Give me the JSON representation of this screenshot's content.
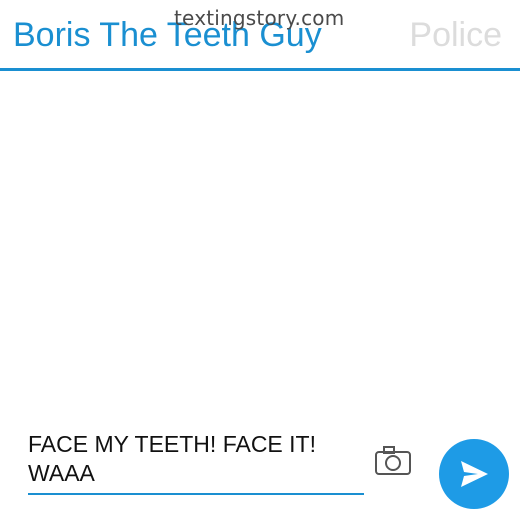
{
  "watermark": "textingstory.com",
  "header": {
    "active_contact": "Boris The Teeth Guy",
    "inactive_contact": "Police"
  },
  "composer": {
    "text": "FACE MY TEETH! FACE IT!\nWAAA"
  },
  "icons": {
    "camera": "camera-icon",
    "send": "send-icon"
  },
  "colors": {
    "accent": "#1a8fd1",
    "send_button": "#1e9be6",
    "inactive_tab": "#dcdcdc"
  }
}
